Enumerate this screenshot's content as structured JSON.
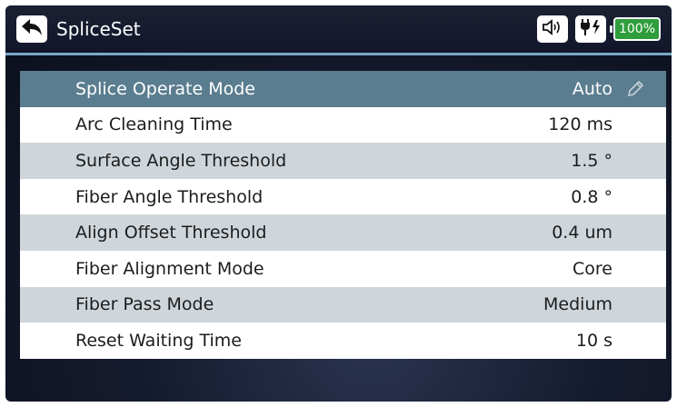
{
  "header": {
    "title": "SpliceSet",
    "back_icon": "back-arrow-icon",
    "status": {
      "speaker_icon": "speaker-icon",
      "power_icon": "power-plug-icon",
      "battery_text": "100%",
      "battery_color": "#2e9d3b"
    }
  },
  "settings": [
    {
      "label": "Splice Operate Mode",
      "value": "Auto",
      "selected": true,
      "editable": true
    },
    {
      "label": "Arc Cleaning Time",
      "value": "120 ms"
    },
    {
      "label": "Surface Angle Threshold",
      "value": "1.5 °"
    },
    {
      "label": "Fiber Angle Threshold",
      "value": "0.8 °"
    },
    {
      "label": "Align Offset Threshold",
      "value": "0.4 um"
    },
    {
      "label": "Fiber Alignment Mode",
      "value": "Core"
    },
    {
      "label": "Fiber Pass Mode",
      "value": "Medium"
    },
    {
      "label": "Reset Waiting Time",
      "value": "10 s"
    }
  ],
  "colors": {
    "selected_row": "#5a7d8f",
    "alt_row": "#cfd6db",
    "header_rule": "#79a8c4"
  }
}
